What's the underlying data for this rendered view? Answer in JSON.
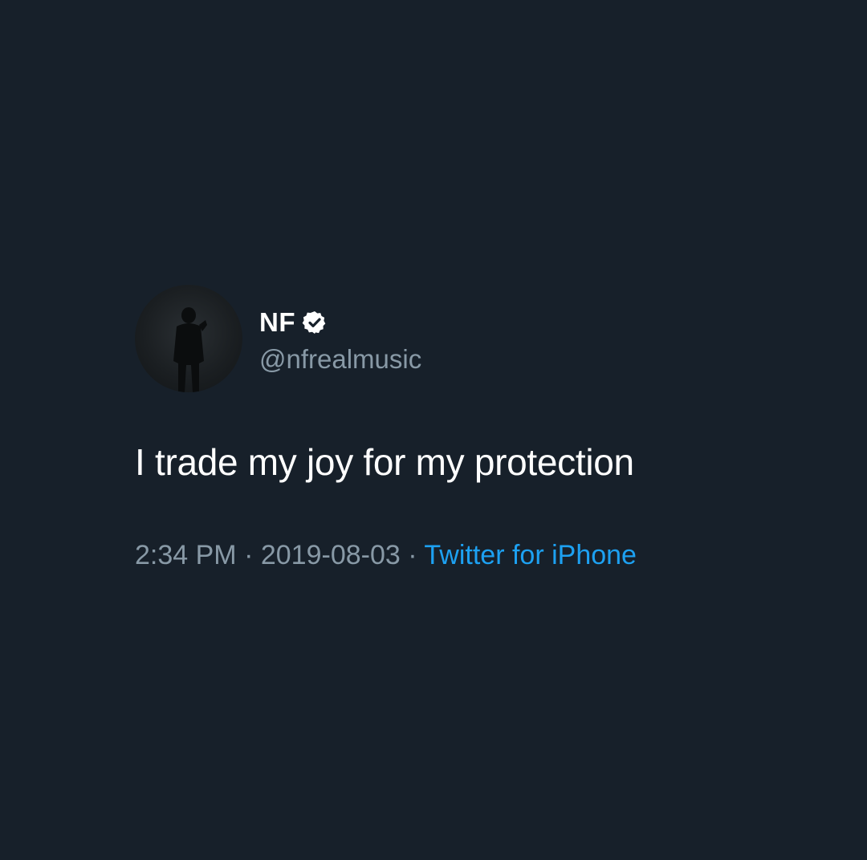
{
  "tweet": {
    "display_name": "NF",
    "handle": "@nfrealmusic",
    "text": "I trade my joy for my protection",
    "time": "2:34 PM",
    "separator": "·",
    "date": "2019-08-03",
    "source": "Twitter for iPhone"
  },
  "icons": {
    "verified": "verified-badge-icon"
  },
  "colors": {
    "background": "#17202a",
    "name": "#ffffff",
    "secondary_text": "#8899a6",
    "link": "#1da1f2"
  }
}
